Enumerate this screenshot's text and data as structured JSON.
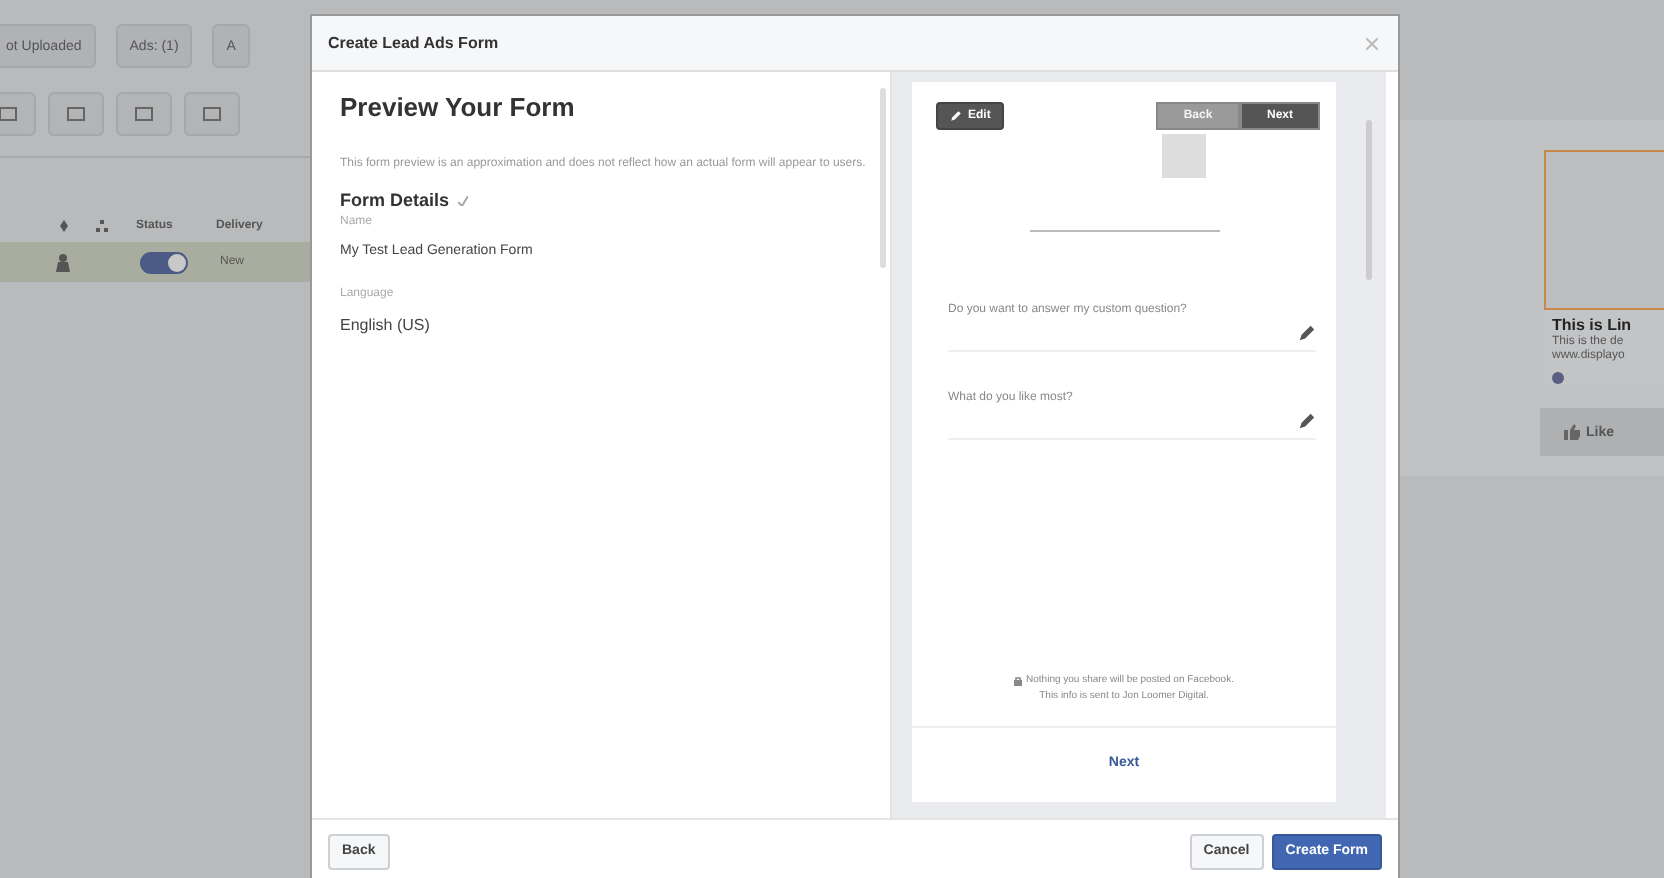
{
  "background": {
    "tabs": [
      {
        "label": "ot Uploaded"
      },
      {
        "label": "Ads: (1)"
      },
      {
        "label": "A"
      }
    ],
    "table": {
      "columns": [
        "Status",
        "Delivery"
      ],
      "rows": [
        {
          "on": true,
          "delivery": "New"
        }
      ]
    },
    "ad_preview": {
      "headline": "This is Lin",
      "description": "This is the de",
      "url": "www.displayo",
      "like": "Like"
    }
  },
  "modal": {
    "title": "Create Lead Ads Form",
    "heading": "Preview Your Form",
    "note": "This form preview is an approximation and does not reflect how an actual form will appear to users.",
    "section": "Form Details",
    "fields": [
      {
        "label": "Name",
        "value": "My Test Lead Generation Form"
      },
      {
        "label": "Language",
        "value": "English (US)"
      }
    ],
    "preview": {
      "edit": "Edit",
      "nav": [
        {
          "label": "Back",
          "disabled": true
        },
        {
          "label": "Next",
          "disabled": false
        }
      ],
      "questions": [
        "Do you want to answer my custom question?",
        "What do you like most?"
      ],
      "privacy": [
        "Nothing you share will be posted on Facebook.",
        "This info is sent to Jon Loomer Digital."
      ],
      "next": "Next"
    },
    "footer": {
      "back": "Back",
      "cancel": "Cancel",
      "create": "Create Form"
    }
  }
}
